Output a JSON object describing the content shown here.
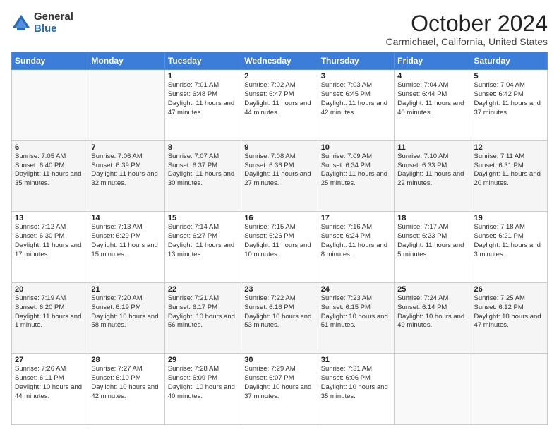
{
  "logo": {
    "general": "General",
    "blue": "Blue"
  },
  "title": "October 2024",
  "subtitle": "Carmichael, California, United States",
  "days_of_week": [
    "Sunday",
    "Monday",
    "Tuesday",
    "Wednesday",
    "Thursday",
    "Friday",
    "Saturday"
  ],
  "weeks": [
    [
      {
        "day": "",
        "content": ""
      },
      {
        "day": "",
        "content": ""
      },
      {
        "day": "1",
        "content": "Sunrise: 7:01 AM\nSunset: 6:48 PM\nDaylight: 11 hours and 47 minutes."
      },
      {
        "day": "2",
        "content": "Sunrise: 7:02 AM\nSunset: 6:47 PM\nDaylight: 11 hours and 44 minutes."
      },
      {
        "day": "3",
        "content": "Sunrise: 7:03 AM\nSunset: 6:45 PM\nDaylight: 11 hours and 42 minutes."
      },
      {
        "day": "4",
        "content": "Sunrise: 7:04 AM\nSunset: 6:44 PM\nDaylight: 11 hours and 40 minutes."
      },
      {
        "day": "5",
        "content": "Sunrise: 7:04 AM\nSunset: 6:42 PM\nDaylight: 11 hours and 37 minutes."
      }
    ],
    [
      {
        "day": "6",
        "content": "Sunrise: 7:05 AM\nSunset: 6:40 PM\nDaylight: 11 hours and 35 minutes."
      },
      {
        "day": "7",
        "content": "Sunrise: 7:06 AM\nSunset: 6:39 PM\nDaylight: 11 hours and 32 minutes."
      },
      {
        "day": "8",
        "content": "Sunrise: 7:07 AM\nSunset: 6:37 PM\nDaylight: 11 hours and 30 minutes."
      },
      {
        "day": "9",
        "content": "Sunrise: 7:08 AM\nSunset: 6:36 PM\nDaylight: 11 hours and 27 minutes."
      },
      {
        "day": "10",
        "content": "Sunrise: 7:09 AM\nSunset: 6:34 PM\nDaylight: 11 hours and 25 minutes."
      },
      {
        "day": "11",
        "content": "Sunrise: 7:10 AM\nSunset: 6:33 PM\nDaylight: 11 hours and 22 minutes."
      },
      {
        "day": "12",
        "content": "Sunrise: 7:11 AM\nSunset: 6:31 PM\nDaylight: 11 hours and 20 minutes."
      }
    ],
    [
      {
        "day": "13",
        "content": "Sunrise: 7:12 AM\nSunset: 6:30 PM\nDaylight: 11 hours and 17 minutes."
      },
      {
        "day": "14",
        "content": "Sunrise: 7:13 AM\nSunset: 6:29 PM\nDaylight: 11 hours and 15 minutes."
      },
      {
        "day": "15",
        "content": "Sunrise: 7:14 AM\nSunset: 6:27 PM\nDaylight: 11 hours and 13 minutes."
      },
      {
        "day": "16",
        "content": "Sunrise: 7:15 AM\nSunset: 6:26 PM\nDaylight: 11 hours and 10 minutes."
      },
      {
        "day": "17",
        "content": "Sunrise: 7:16 AM\nSunset: 6:24 PM\nDaylight: 11 hours and 8 minutes."
      },
      {
        "day": "18",
        "content": "Sunrise: 7:17 AM\nSunset: 6:23 PM\nDaylight: 11 hours and 5 minutes."
      },
      {
        "day": "19",
        "content": "Sunrise: 7:18 AM\nSunset: 6:21 PM\nDaylight: 11 hours and 3 minutes."
      }
    ],
    [
      {
        "day": "20",
        "content": "Sunrise: 7:19 AM\nSunset: 6:20 PM\nDaylight: 11 hours and 1 minute."
      },
      {
        "day": "21",
        "content": "Sunrise: 7:20 AM\nSunset: 6:19 PM\nDaylight: 10 hours and 58 minutes."
      },
      {
        "day": "22",
        "content": "Sunrise: 7:21 AM\nSunset: 6:17 PM\nDaylight: 10 hours and 56 minutes."
      },
      {
        "day": "23",
        "content": "Sunrise: 7:22 AM\nSunset: 6:16 PM\nDaylight: 10 hours and 53 minutes."
      },
      {
        "day": "24",
        "content": "Sunrise: 7:23 AM\nSunset: 6:15 PM\nDaylight: 10 hours and 51 minutes."
      },
      {
        "day": "25",
        "content": "Sunrise: 7:24 AM\nSunset: 6:14 PM\nDaylight: 10 hours and 49 minutes."
      },
      {
        "day": "26",
        "content": "Sunrise: 7:25 AM\nSunset: 6:12 PM\nDaylight: 10 hours and 47 minutes."
      }
    ],
    [
      {
        "day": "27",
        "content": "Sunrise: 7:26 AM\nSunset: 6:11 PM\nDaylight: 10 hours and 44 minutes."
      },
      {
        "day": "28",
        "content": "Sunrise: 7:27 AM\nSunset: 6:10 PM\nDaylight: 10 hours and 42 minutes."
      },
      {
        "day": "29",
        "content": "Sunrise: 7:28 AM\nSunset: 6:09 PM\nDaylight: 10 hours and 40 minutes."
      },
      {
        "day": "30",
        "content": "Sunrise: 7:29 AM\nSunset: 6:07 PM\nDaylight: 10 hours and 37 minutes."
      },
      {
        "day": "31",
        "content": "Sunrise: 7:31 AM\nSunset: 6:06 PM\nDaylight: 10 hours and 35 minutes."
      },
      {
        "day": "",
        "content": ""
      },
      {
        "day": "",
        "content": ""
      }
    ]
  ]
}
